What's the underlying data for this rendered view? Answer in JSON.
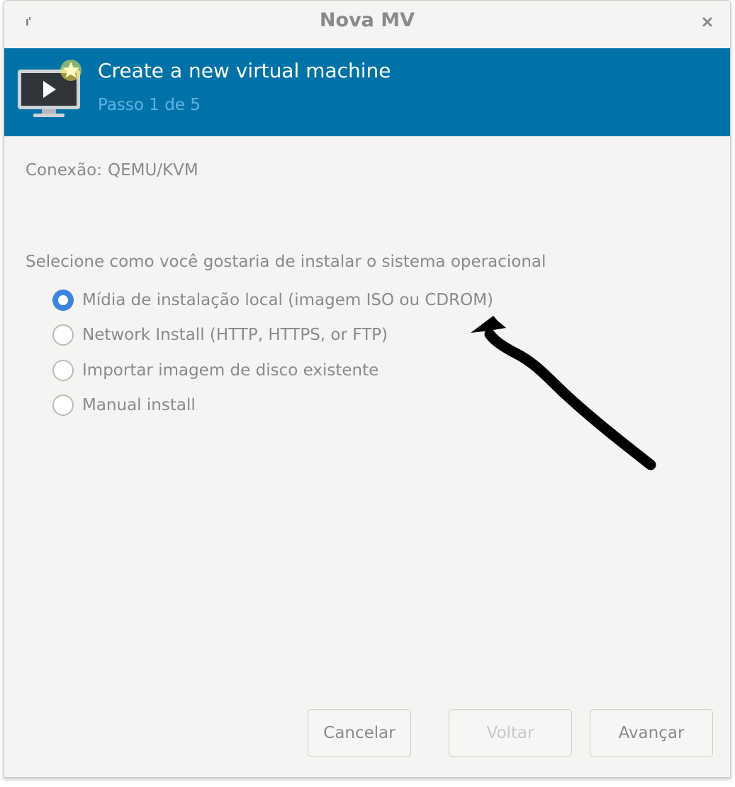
{
  "window": {
    "title": "Nova MV"
  },
  "banner": {
    "title": "Create a new virtual machine",
    "step": "Passo 1 de 5",
    "background_color": "#0072a8",
    "icon": "vm-monitor-new-icon"
  },
  "connection": {
    "label": "Conexão:",
    "value": "QEMU/KVM"
  },
  "install": {
    "prompt": "Selecione como você gostaria de instalar o sistema operacional",
    "options": [
      {
        "label": "Mídia de instalação local (imagem ISO ou CDROM)",
        "selected": true
      },
      {
        "label": "Network Install (HTTP, HTTPS, or FTP)",
        "selected": false
      },
      {
        "label": "Importar imagem de disco existente",
        "selected": false
      },
      {
        "label": "Manual install",
        "selected": false
      }
    ]
  },
  "annotation": {
    "icon": "hand-drawn-arrow-icon",
    "color": "#000000"
  },
  "buttons": {
    "cancel": "Cancelar",
    "back": "Voltar",
    "back_enabled": false,
    "forward": "Avançar"
  }
}
